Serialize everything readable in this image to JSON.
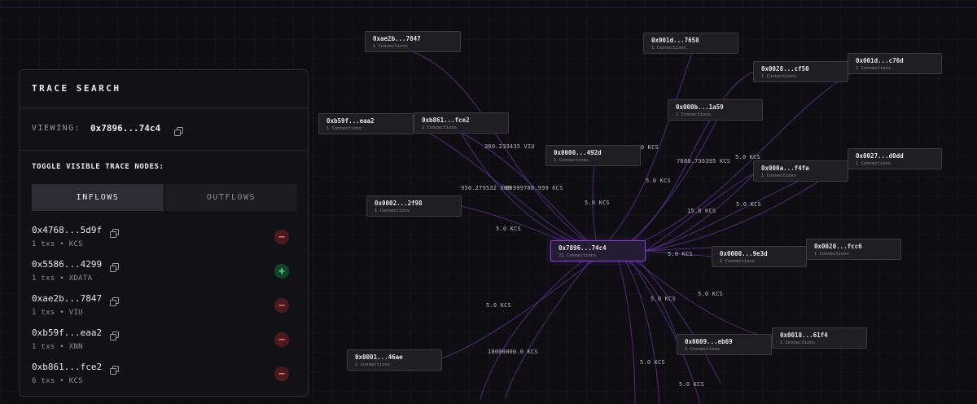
{
  "panel": {
    "title": "TRACE SEARCH",
    "viewing_label": "VIEWING:",
    "viewing_address": "0x7896...74c4",
    "toggle_title": "TOGGLE VISIBLE TRACE NODES:",
    "tabs": {
      "inflows": "INFLOWS",
      "outflows": "OUTFLOWS"
    },
    "active_tab": "INFLOWS",
    "rows": [
      {
        "address": "0x4768...5d9f",
        "meta": "1 txs • KCS",
        "action": "remove"
      },
      {
        "address": "0x5586...4299",
        "meta": "1 txs • XDATA",
        "action": "add"
      },
      {
        "address": "0xae2b...7847",
        "meta": "1 txs • VIU",
        "action": "remove"
      },
      {
        "address": "0xb59f...eaa2",
        "meta": "1 txs • XNN",
        "action": "remove"
      },
      {
        "address": "0xb861...fce2",
        "meta": "6 txs • KCS",
        "action": "remove"
      }
    ]
  },
  "graph": {
    "center": {
      "address": "0x7896...74c4",
      "connections": "21 Connections"
    },
    "nodes": [
      {
        "address": "0xae2b...7847",
        "connections": "1 Connections"
      },
      {
        "address": "0xb59f...eaa2",
        "connections": "1 Connections"
      },
      {
        "address": "0xb861...fce2",
        "connections": "2 Connections"
      },
      {
        "address": "0x0002...2f98",
        "connections": "1 Connections"
      },
      {
        "address": "0x0000...492d",
        "connections": "1 Connections"
      },
      {
        "address": "0x001d...7658",
        "connections": "1 Connections"
      },
      {
        "address": "0x0028...cf50",
        "connections": "1 Connections"
      },
      {
        "address": "0x001d...c76d",
        "connections": "1 Connections"
      },
      {
        "address": "0x000b...1a59",
        "connections": "1 Connections"
      },
      {
        "address": "0x000a...f4fa",
        "connections": "1 Connections"
      },
      {
        "address": "0x0027...d0dd",
        "connections": "1 Connections"
      },
      {
        "address": "0x0000...9e3d",
        "connections": "1 Connections"
      },
      {
        "address": "0x0020...fcc6",
        "connections": "1 Connections"
      },
      {
        "address": "0x0009...eb69",
        "connections": "1 Connections"
      },
      {
        "address": "0x0018...61f4",
        "connections": "1 Connections"
      },
      {
        "address": "0x0001...46ae",
        "connections": "1 Connections"
      }
    ],
    "edge_labels": [
      "360.233435 VIU",
      "5.0 KCS",
      "950.279532 XNN",
      "99999780.999 KCS",
      "5.0 KCS",
      "5.0 KCS",
      "7880.736395 KCS",
      "5.0 KCS",
      "5.0 KCS",
      "15.0 KCS",
      "5.0 KCS",
      "5.0 KCS",
      "5.0 KCS",
      "5.0 KCS",
      "5.0 KCS",
      "10000000.0 KCS",
      "5.0 KCS",
      "5.0 KCS"
    ]
  }
}
